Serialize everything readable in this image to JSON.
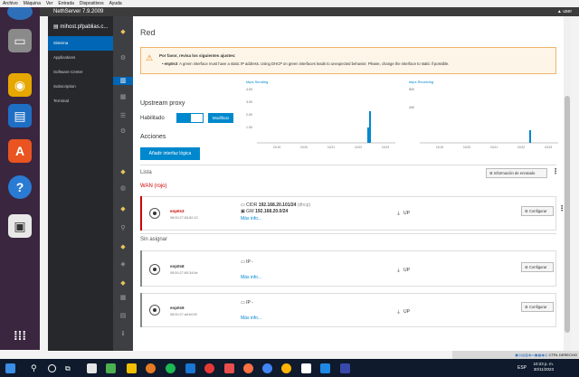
{
  "vbox_menu": [
    "Archivo",
    "Máquina",
    "Ver",
    "Entrada",
    "Dispositivos",
    "Ayuda"
  ],
  "top_title": "NethServer 7.9.2009",
  "top_user": "user",
  "nav": {
    "host": "mihost.pfpablias.c...",
    "items": [
      "Sistema",
      "Applications",
      "Software Center",
      "Subscription",
      "Terminal"
    ]
  },
  "page": {
    "heading": "Red",
    "alert_title": "Por favor, revisa los siguientes ajustes:",
    "alert_item_name": "enp0s3",
    "alert_item_text": ": A green interface must have a static IP address. Using DHCP on green interfaces leads to unexpected behavior. Please, change the interface to static if possible.",
    "upstream_title": "Upstream proxy",
    "habilitado_label": "Habilitado",
    "modificar_label": "Modificar",
    "acciones_title": "Acciones",
    "add_logical_label": "Añadir interfaz lógica",
    "lista_title": "Lista",
    "info_enrutado_label": "Información de enrutado",
    "wan_label": "WAN (rojo)",
    "sin_asignar_label": "Sin asignar"
  },
  "graphs": {
    "sending": {
      "unit": "kbps",
      "label": "Sending",
      "yticks": [
        "4.00",
        "3.00",
        "2.00",
        "1.00"
      ],
      "xticks": [
        "10:19",
        "10:20",
        "10:21",
        "10:22",
        "10:23"
      ]
    },
    "receiving": {
      "unit": "kbps",
      "label": "Receiving",
      "yticks": [
        "800",
        "400"
      ],
      "xticks": [
        "10:19",
        "10:20",
        "10:21",
        "10:22",
        "10:23"
      ]
    }
  },
  "interfaces": [
    {
      "name": "enp0s3",
      "mac": "08:00:27:83:82:1C",
      "cidr_label": "CIDR",
      "cidr": "192.168.20.101/24",
      "cidr_suffix": "(dhcp)",
      "gw_label": "GW",
      "gw": "192.168.20.0/24",
      "mas": "Más info...",
      "status": "UP",
      "configurar": "Configurar",
      "role_color": "#cc0000"
    },
    {
      "name": "enp0s8",
      "mac": "08:00:27:80:34:6e",
      "ip": "IP -",
      "mas": "Más info...",
      "status": "UP",
      "configurar": "Configurar",
      "role_color": "#888888"
    },
    {
      "name": "enp0s9",
      "mac": "08:00:27:a9:b0:f8",
      "ip": "IP -",
      "mas": "Más info...",
      "status": "UP",
      "configurar": "Configurar",
      "role_color": "#888888"
    }
  ],
  "tray_text": "CTRL DERECHO",
  "taskbar": {
    "lang": "ESP",
    "time": "10:23 p. m.",
    "date": "30/11/2023"
  }
}
